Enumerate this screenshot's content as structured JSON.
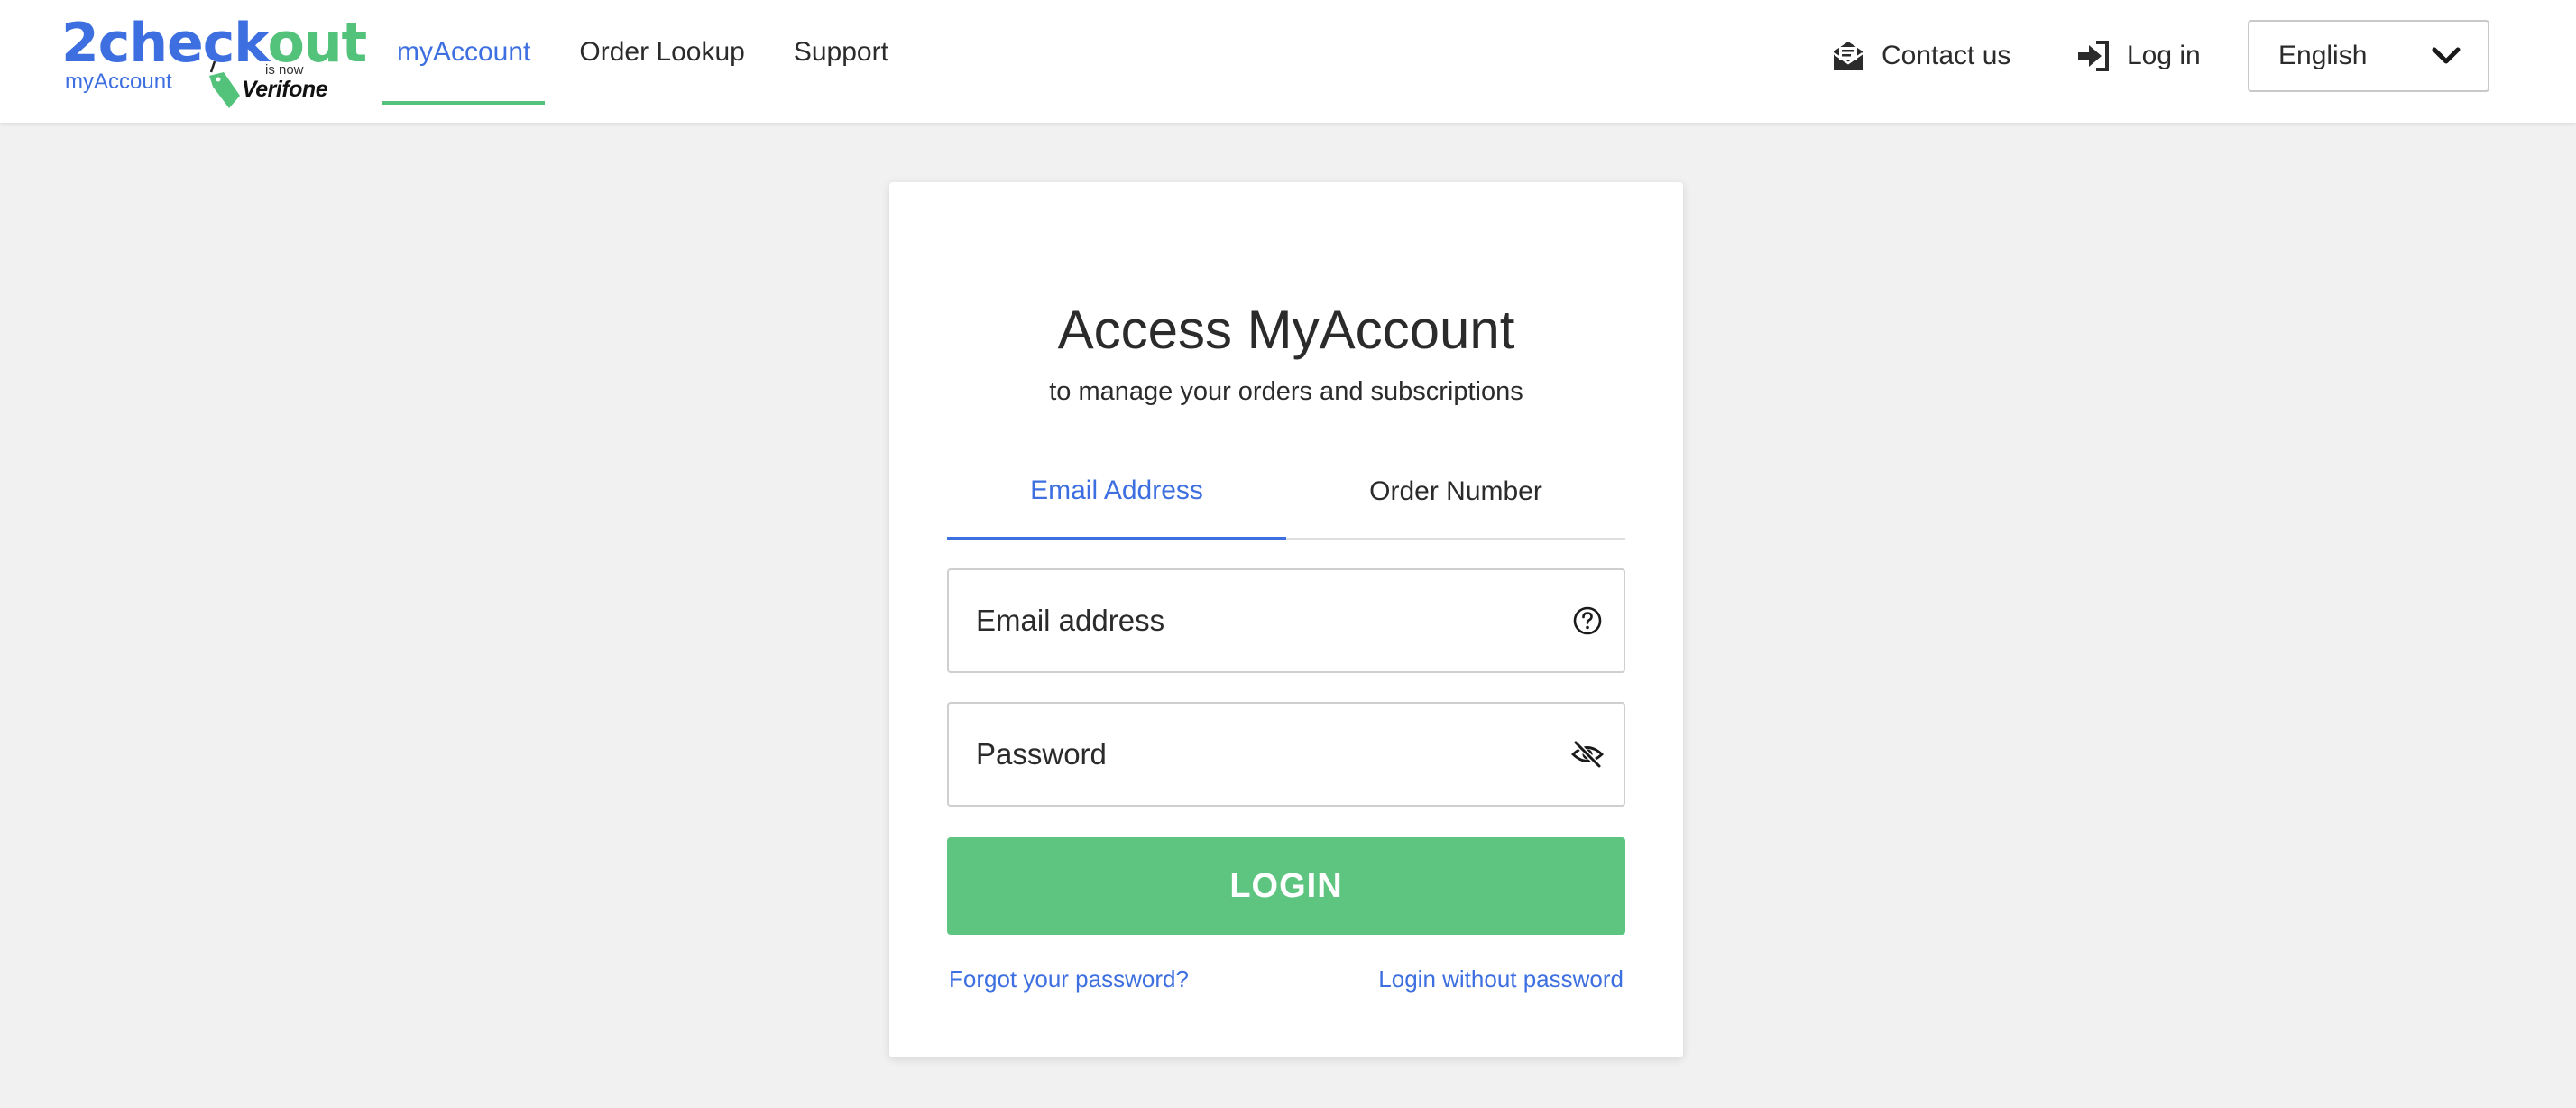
{
  "logo": {
    "brand_part1": "2chec",
    "brand_part2": "k",
    "brand_part3": "out",
    "sub": "myAccount",
    "is_now": "is now",
    "verifone": "Verifone"
  },
  "nav": {
    "items": [
      {
        "label": "myAccount",
        "active": true
      },
      {
        "label": "Order Lookup",
        "active": false
      },
      {
        "label": "Support",
        "active": false
      }
    ]
  },
  "header_right": {
    "contact_label": "Contact us",
    "contact_icon": "envelope-open-icon",
    "login_label": "Log in",
    "login_icon": "sign-in-icon",
    "language_value": "English",
    "language_icon": "chevron-down-icon"
  },
  "card": {
    "title": "Access MyAccount",
    "subtitle": "to manage your orders and subscriptions",
    "tabs": [
      {
        "label": "Email Address",
        "active": true
      },
      {
        "label": "Order Number",
        "active": false
      }
    ],
    "email_placeholder": "Email address",
    "email_help_icon": "question-circle-icon",
    "password_placeholder": "Password",
    "password_icon": "eye-slash-icon",
    "login_button": "LOGIN",
    "forgot_link": "Forgot your password?",
    "passwordless_link": "Login without password"
  },
  "colors": {
    "accent_blue": "#3d6fe0",
    "accent_green": "#53c27a",
    "button_green": "#5dc57f",
    "background": "#f1f1f1"
  }
}
